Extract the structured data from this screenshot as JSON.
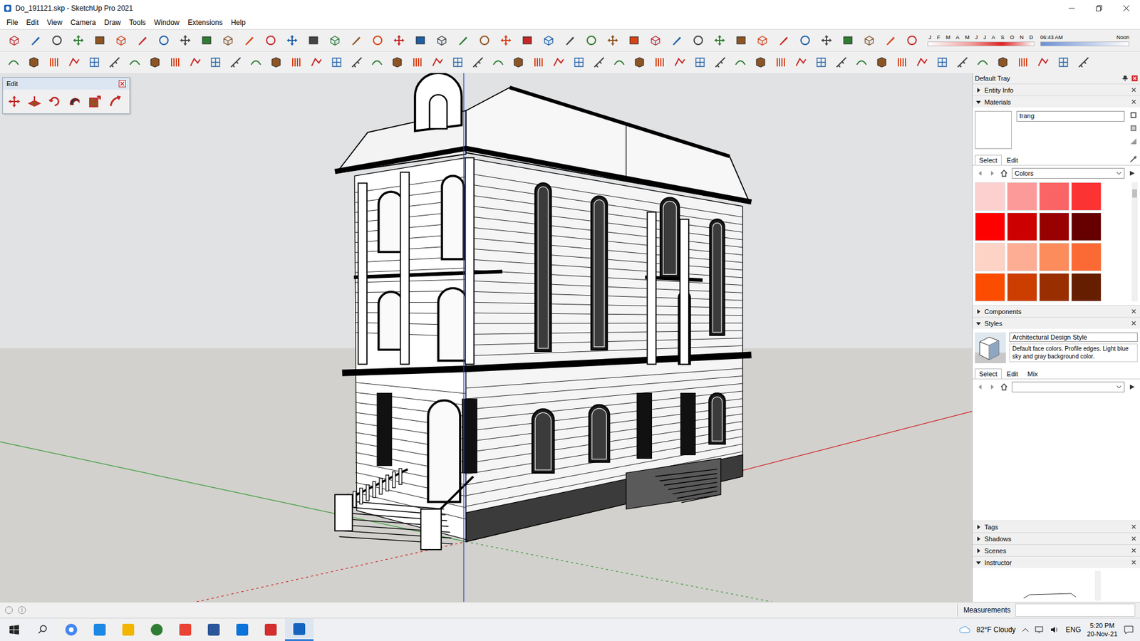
{
  "window": {
    "title": "Do_191121.skp - SketchUp Pro 2021"
  },
  "menu": [
    "File",
    "Edit",
    "View",
    "Camera",
    "Draw",
    "Tools",
    "Window",
    "Extensions",
    "Help"
  ],
  "shadow_bar": {
    "months": [
      "J",
      "F",
      "M",
      "A",
      "M",
      "J",
      "J",
      "A",
      "S",
      "O",
      "N",
      "D"
    ],
    "time": "06:43 AM",
    "noon": "Noon"
  },
  "edit_toolbar": {
    "title": "Edit"
  },
  "tray": {
    "title": "Default Tray",
    "panels": [
      {
        "label": "Entity Info",
        "expanded": false,
        "kind": "info"
      },
      {
        "label": "Materials",
        "expanded": true,
        "kind": "materials"
      },
      {
        "label": "Components",
        "expanded": false,
        "kind": "components"
      },
      {
        "label": "Styles",
        "expanded": true,
        "kind": "styles"
      },
      {
        "label": "Tags",
        "expanded": false,
        "kind": "tags"
      },
      {
        "label": "Shadows",
        "expanded": false,
        "kind": "shadows"
      },
      {
        "label": "Scenes",
        "expanded": false,
        "kind": "scenes"
      },
      {
        "label": "Instructor",
        "expanded": true,
        "kind": "instructor"
      }
    ]
  },
  "materials": {
    "name": "trang",
    "tabs": [
      {
        "label": "Select",
        "selected": true
      },
      {
        "label": "Edit",
        "selected": false
      }
    ],
    "library": "Colors",
    "swatches": [
      {
        "color": "#fdd0d0"
      },
      {
        "color": "#fc9a9a"
      },
      {
        "color": "#fb6464"
      },
      {
        "color": "#fb3333"
      },
      {
        "color": "#fd0000"
      },
      {
        "color": "#cc0000"
      },
      {
        "color": "#990000"
      },
      {
        "color": "#660000"
      },
      {
        "color": "#fdd3c6"
      },
      {
        "color": "#fdad94"
      },
      {
        "color": "#fb8c5c"
      },
      {
        "color": "#fb6a34"
      },
      {
        "color": "#fc4c00"
      },
      {
        "color": "#cc3d00"
      },
      {
        "color": "#992e00"
      },
      {
        "color": "#661e00"
      }
    ]
  },
  "styles": {
    "name": "Architectural Design Style",
    "description": "Default face colors. Profile edges. Light blue sky and gray background color.",
    "tabs": [
      {
        "label": "Select",
        "selected": true
      },
      {
        "label": "Edit",
        "selected": false
      },
      {
        "label": "Mix",
        "selected": false
      }
    ],
    "library": ""
  },
  "status_bar": {
    "measurements": "Measurements"
  },
  "taskbar": {
    "weather": "82°F Cloudy",
    "language": "ENG",
    "time": "5:20 PM",
    "date": "20-Nov-21"
  }
}
